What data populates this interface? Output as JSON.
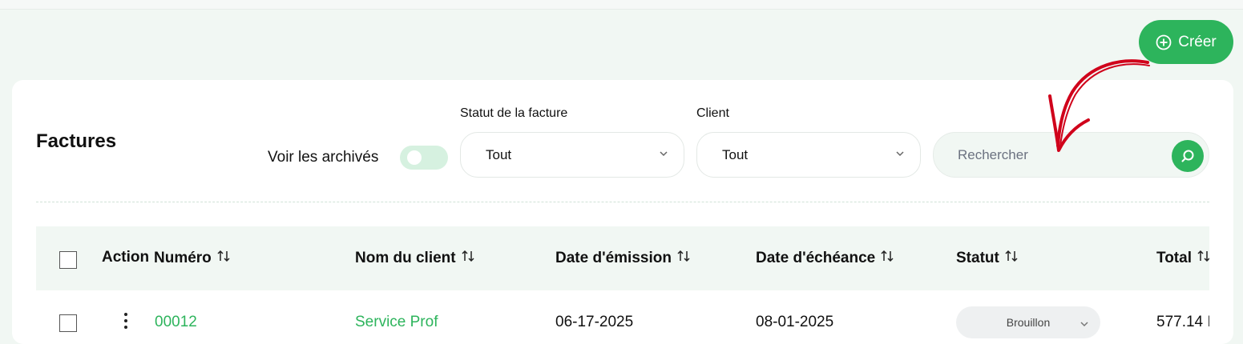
{
  "header": {
    "create_label": "Créer"
  },
  "page": {
    "title": "Factures",
    "archive_toggle_label": "Voir les archivés",
    "archive_toggle_on": false
  },
  "filters": {
    "status_label": "Statut de la facture",
    "status_value": "Tout",
    "client_label": "Client",
    "client_value": "Tout",
    "search_placeholder": "Rechercher"
  },
  "table": {
    "columns": {
      "action": "Action",
      "number": "Numéro",
      "client": "Nom du client",
      "issue_date": "Date d'émission",
      "due_date": "Date d'échéance",
      "status": "Statut",
      "total": "Total"
    },
    "rows": [
      {
        "number": "00012",
        "client": "Service Prof",
        "issue_date": "06-17-2025",
        "due_date": "08-01-2025",
        "status": "Brouillon",
        "total": "577.14 I"
      }
    ]
  },
  "colors": {
    "accent": "#2db45c",
    "annotation_arrow": "#d0021b"
  },
  "icons": {
    "create": "plus-circle-icon",
    "search": "search-icon",
    "sort": "sort-arrows-icon",
    "dropdown": "chevron-down-icon",
    "row_menu": "kebab-menu-icon"
  }
}
